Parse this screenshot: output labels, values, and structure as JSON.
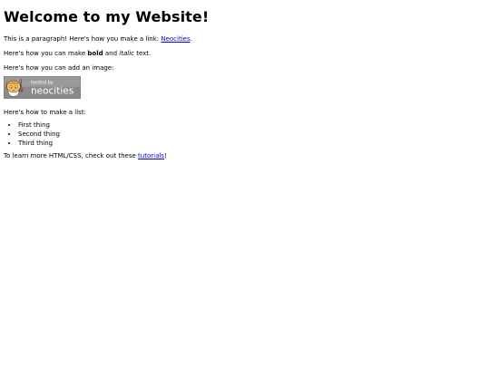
{
  "heading": "Welcome to my Website!",
  "para1": {
    "text": "This is a paragraph! Here's how you make a link: ",
    "link": "Neocities",
    "end": "."
  },
  "para2": {
    "pre": "Here's how you can make ",
    "bold": "bold",
    "mid": " and ",
    "italic": "italic",
    "end": " text."
  },
  "para3": "Here's how you can add an image:",
  "badge": {
    "top": "hosted by",
    "name": "neocities"
  },
  "para4": "Here's how to make a list:",
  "list": [
    "First thing",
    "Second thing",
    "Third thing"
  ],
  "para5": {
    "text": "To learn more HTML/CSS, check out these ",
    "link": "tutorials",
    "end": "!"
  },
  "colors": {
    "link": "#0000ee",
    "badge_bg": "#8a8a8a",
    "badge_text": "#ffffff"
  }
}
